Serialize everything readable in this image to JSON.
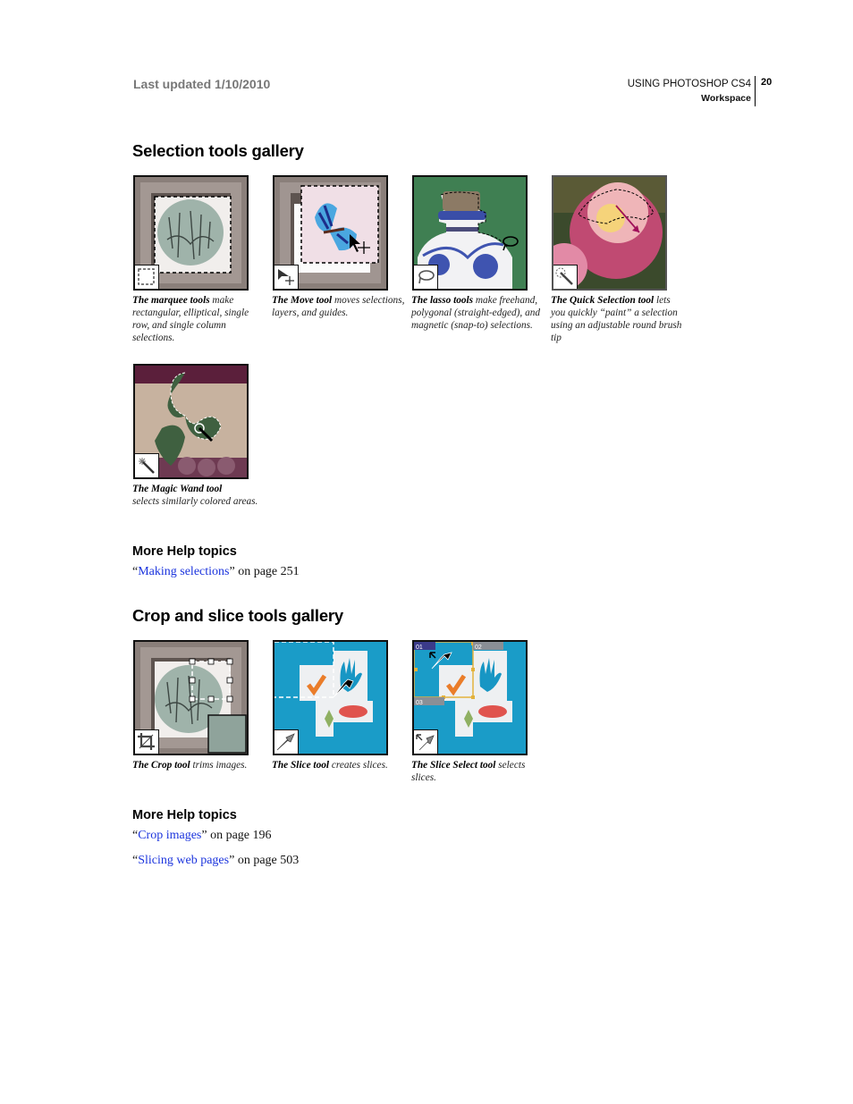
{
  "header": {
    "last_updated": "Last updated 1/10/2010",
    "book_title": "USING PHOTOSHOP CS4",
    "section": "Workspace",
    "page_number": "20"
  },
  "selection_gallery": {
    "title": "Selection tools gallery",
    "figures": [
      {
        "tool": "The marquee tools",
        "desc": " make rectangular, elliptical, single row, and single column selections.",
        "icon": "marquee-icon"
      },
      {
        "tool": "The Move tool",
        "desc": " moves selections, layers, and guides.",
        "icon": "move-icon"
      },
      {
        "tool": "The lasso tools",
        "desc": " make freehand, polygonal (straight-edged), and magnetic (snap-to) selections.",
        "icon": "lasso-icon"
      },
      {
        "tool": "The Quick Selection tool",
        "desc": " lets you quickly “paint” a selection using an adjustable round brush tip",
        "icon": "quick-selection-icon"
      },
      {
        "tool": "The Magic Wand tool",
        "desc": " selects similarly colored areas.",
        "icon": "magic-wand-icon"
      }
    ],
    "more_help": {
      "title": "More Help topics",
      "links": [
        {
          "open_quote": "“",
          "text": "Making selections",
          "close_quote": "”",
          "suffix": " on page 251"
        }
      ]
    }
  },
  "crop_gallery": {
    "title": "Crop and slice tools gallery",
    "figures": [
      {
        "tool": "The Crop tool",
        "desc": " trims images.",
        "icon": "crop-icon"
      },
      {
        "tool": "The Slice tool",
        "desc": " creates slices.",
        "icon": "slice-icon"
      },
      {
        "tool": "The Slice Select tool",
        "desc": " selects slices.",
        "icon": "slice-select-icon"
      }
    ],
    "slice_labels": [
      "01",
      "02",
      "03"
    ],
    "more_help": {
      "title": "More Help topics",
      "links": [
        {
          "open_quote": "“",
          "text": "Crop images",
          "close_quote": "”",
          "suffix": " on page 196"
        },
        {
          "open_quote": "“",
          "text": "Slicing web pages",
          "close_quote": "”",
          "suffix": " on page 503"
        }
      ]
    }
  },
  "colors": {
    "link": "#1a33dd",
    "header_gray": "#777777",
    "slice_blue": "#1a9cc8"
  }
}
